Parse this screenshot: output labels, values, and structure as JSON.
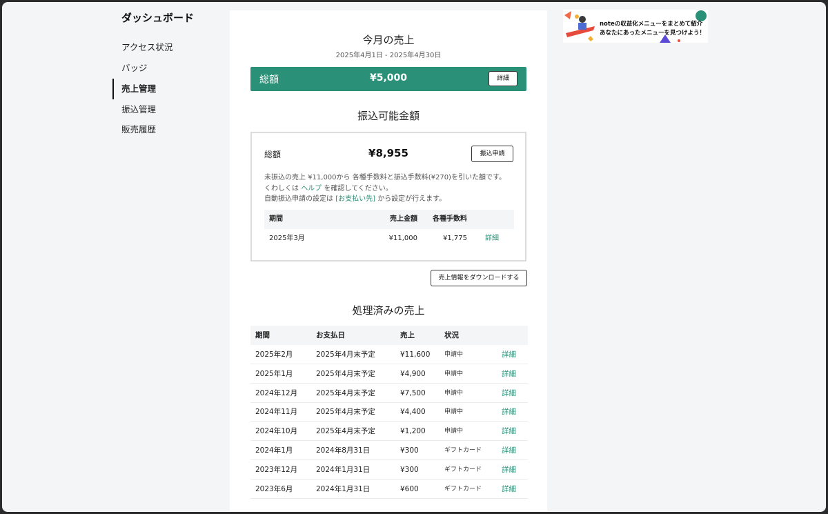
{
  "sidebar": {
    "title": "ダッシュボード",
    "items": [
      {
        "label": "アクセス状況"
      },
      {
        "label": "バッジ"
      },
      {
        "label": "売上管理"
      },
      {
        "label": "振込管理"
      },
      {
        "label": "販売履歴"
      }
    ]
  },
  "monthly": {
    "title": "今月の売上",
    "range": "2025年4月1日 - 2025年4月30日",
    "total_label": "総額",
    "total_amount": "¥5,000",
    "detail_button": "詳細",
    "bar_color": "#2a9077"
  },
  "transferable": {
    "title": "振込可能金額",
    "total_label": "総額",
    "total_amount": "¥8,955",
    "apply_button": "振込申請",
    "note1": "未振込の売上 ¥11,000から 各種手数料と振込手数料(¥270)を引いた額です。",
    "note2_pre": "くわしくは",
    "note2_link": "ヘルプ",
    "note2_post": "を確認してください。",
    "note3_pre": "自動振込申請の設定は",
    "note3_link": "[お支払い先]",
    "note3_post": "から設定が行えます。",
    "table": {
      "headers": {
        "period": "期間",
        "sales": "売上金額",
        "fee": "各種手数料"
      },
      "rows": [
        {
          "period": "2025年3月",
          "sales": "¥11,000",
          "fee": "¥1,775",
          "link": "詳細"
        }
      ]
    }
  },
  "download_button": "売上情報をダウンロードする",
  "processed": {
    "title": "処理済みの売上",
    "headers": {
      "period": "期間",
      "pay_date": "お支払日",
      "sales": "売上",
      "status": "状況"
    },
    "rows": [
      {
        "period": "2025年2月",
        "pay_date": "2025年4月末予定",
        "sales": "¥11,600",
        "status": "申請中",
        "link": "詳細"
      },
      {
        "period": "2025年1月",
        "pay_date": "2025年4月末予定",
        "sales": "¥4,900",
        "status": "申請中",
        "link": "詳細"
      },
      {
        "period": "2024年12月",
        "pay_date": "2025年4月末予定",
        "sales": "¥7,500",
        "status": "申請中",
        "link": "詳細"
      },
      {
        "period": "2024年11月",
        "pay_date": "2025年4月末予定",
        "sales": "¥4,400",
        "status": "申請中",
        "link": "詳細"
      },
      {
        "period": "2024年10月",
        "pay_date": "2025年4月末予定",
        "sales": "¥1,200",
        "status": "申請中",
        "link": "詳細"
      },
      {
        "period": "2024年1月",
        "pay_date": "2024年8月31日",
        "sales": "¥300",
        "status": "ギフトカード",
        "link": "詳細"
      },
      {
        "period": "2023年12月",
        "pay_date": "2024年1月31日",
        "sales": "¥300",
        "status": "ギフトカード",
        "link": "詳細"
      },
      {
        "period": "2023年6月",
        "pay_date": "2024年1月31日",
        "sales": "¥600",
        "status": "ギフトカード",
        "link": "詳細"
      }
    ]
  },
  "banner": {
    "line1": "noteの収益化メニューをまとめて紹介",
    "line2": "あなたにあったメニューを見つけよう！",
    "icon": "promo-illustration"
  },
  "colors": {
    "accent": "#2a9077",
    "background": "#f4f5f7"
  }
}
